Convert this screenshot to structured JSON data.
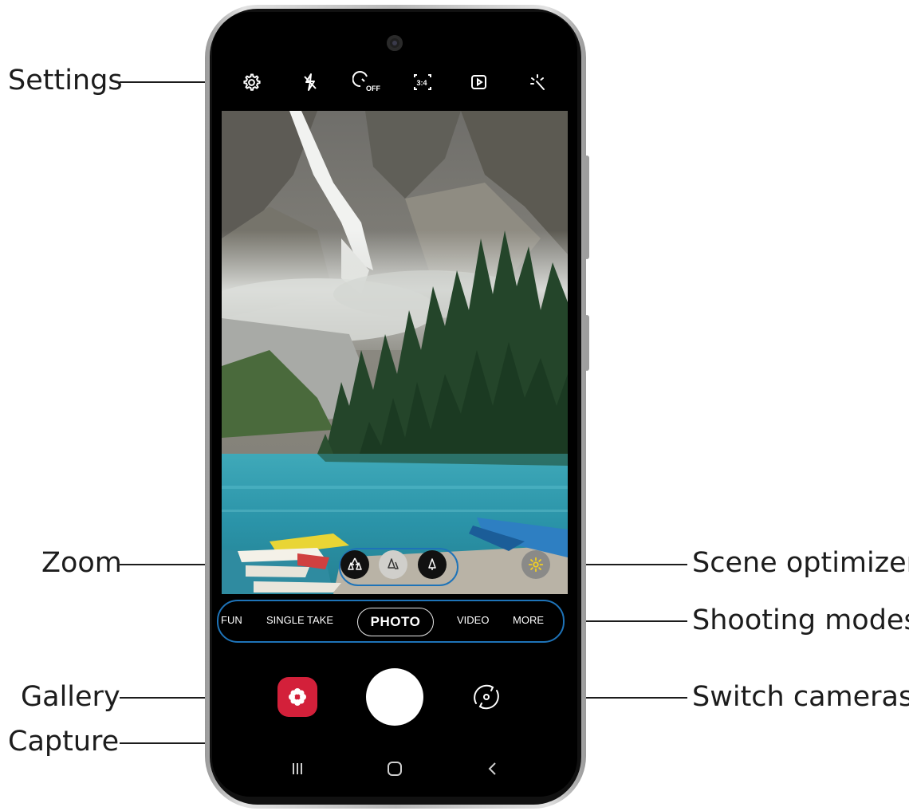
{
  "callouts": {
    "settings": "Settings",
    "zoom": "Zoom",
    "gallery": "Gallery",
    "capture": "Capture",
    "scene_optimizer": "Scene optimizer",
    "shooting_modes": "Shooting modes",
    "switch_cameras": "Switch cameras"
  },
  "top_bar": {
    "icons": [
      "gear-icon",
      "flash-off-icon",
      "timer-off-icon",
      "aspect-ratio-icon",
      "motion-photo-icon",
      "filter-effects-icon"
    ],
    "timer_label": "OFF",
    "ratio_label": "3:4"
  },
  "zoom": {
    "icons": [
      "ultra-wide-trees-icon",
      "wide-tree-icon",
      "tele-tree-icon"
    ]
  },
  "modes": {
    "items": [
      "FUN",
      "SINGLE TAKE",
      "PHOTO",
      "VIDEO",
      "MORE"
    ],
    "active": "PHOTO"
  },
  "colors": {
    "callout_line": "#1c1c1c",
    "highlight_border": "#1e73b8",
    "gallery_red": "#d3203a",
    "scene_icon_yellow": "#f2d022"
  }
}
